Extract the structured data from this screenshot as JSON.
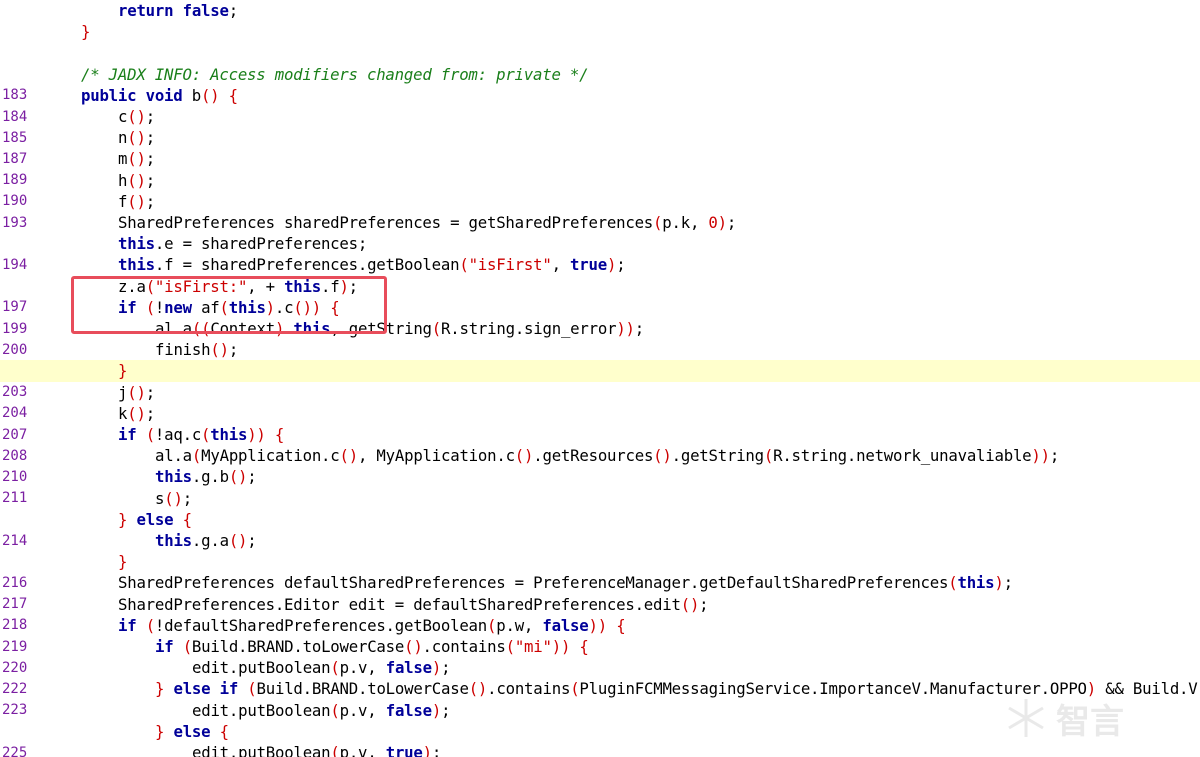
{
  "colors": {
    "keyword": "#000099",
    "string": "#cc0000",
    "bracket": "#cc0000",
    "comment": "#1a7f1a",
    "line_number": "#7b1fa2",
    "current_line_bg": "#ffffcc",
    "annotation_box": "#e84d5b"
  },
  "code_lines": [
    {
      "ln": "",
      "indent": 2,
      "tokens": [
        [
          "kw",
          "return"
        ],
        [
          "",
          " "
        ],
        [
          "kw",
          "false"
        ],
        [
          "",
          ";"
        ]
      ]
    },
    {
      "ln": "",
      "indent": 1,
      "tokens": [
        [
          "br",
          "}"
        ]
      ]
    },
    {
      "ln": "",
      "indent": 0,
      "tokens": []
    },
    {
      "ln": "",
      "indent": 1,
      "tokens": [
        [
          "cm",
          "/* JADX INFO: Access modifiers changed from: private */"
        ]
      ]
    },
    {
      "ln": "183",
      "indent": 1,
      "tokens": [
        [
          "kw",
          "public"
        ],
        [
          "",
          " "
        ],
        [
          "kw",
          "void"
        ],
        [
          "",
          " b"
        ],
        [
          "br",
          "()"
        ],
        [
          "",
          " "
        ],
        [
          "br",
          "{"
        ]
      ]
    },
    {
      "ln": "184",
      "indent": 2,
      "tokens": [
        [
          "",
          "c"
        ],
        [
          "br",
          "()"
        ],
        [
          "",
          ";"
        ]
      ]
    },
    {
      "ln": "185",
      "indent": 2,
      "tokens": [
        [
          "",
          "n"
        ],
        [
          "br",
          "()"
        ],
        [
          "",
          ";"
        ]
      ]
    },
    {
      "ln": "187",
      "indent": 2,
      "tokens": [
        [
          "",
          "m"
        ],
        [
          "br",
          "()"
        ],
        [
          "",
          ";"
        ]
      ]
    },
    {
      "ln": "189",
      "indent": 2,
      "tokens": [
        [
          "",
          "h"
        ],
        [
          "br",
          "()"
        ],
        [
          "",
          ";"
        ]
      ]
    },
    {
      "ln": "190",
      "indent": 2,
      "tokens": [
        [
          "",
          "f"
        ],
        [
          "br",
          "()"
        ],
        [
          "",
          ";"
        ]
      ]
    },
    {
      "ln": "193",
      "indent": 2,
      "tokens": [
        [
          "",
          "SharedPreferences sharedPreferences = getSharedPreferences"
        ],
        [
          "br",
          "("
        ],
        [
          "",
          "p.k, "
        ],
        [
          "nm",
          "0"
        ],
        [
          "br",
          ")"
        ],
        [
          "",
          ";"
        ]
      ]
    },
    {
      "ln": "",
      "indent": 2,
      "tokens": [
        [
          "kw",
          "this"
        ],
        [
          "",
          ".e = sharedPreferences;"
        ]
      ]
    },
    {
      "ln": "194",
      "indent": 2,
      "tokens": [
        [
          "kw",
          "this"
        ],
        [
          "",
          ".f = sharedPreferences.getBoolean"
        ],
        [
          "br",
          "("
        ],
        [
          "st",
          "\"isFirst\""
        ],
        [
          "",
          ", "
        ],
        [
          "kw",
          "true"
        ],
        [
          "br",
          ")"
        ],
        [
          "",
          ";"
        ]
      ]
    },
    {
      "ln": "",
      "indent": 2,
      "tokens": [
        [
          "",
          "z.a"
        ],
        [
          "br",
          "("
        ],
        [
          "st",
          "\"isFirst:\""
        ],
        [
          "",
          ", + "
        ],
        [
          "kw",
          "this"
        ],
        [
          "",
          ".f"
        ],
        [
          "br",
          ")"
        ],
        [
          "",
          ";"
        ]
      ]
    },
    {
      "ln": "197",
      "indent": 2,
      "tokens": [
        [
          "kw",
          "if"
        ],
        [
          "",
          " "
        ],
        [
          "br",
          "("
        ],
        [
          "",
          "!"
        ],
        [
          "kw",
          "new"
        ],
        [
          "",
          " af"
        ],
        [
          "br",
          "("
        ],
        [
          "kw",
          "this"
        ],
        [
          "br",
          ")"
        ],
        [
          "",
          ".c"
        ],
        [
          "br",
          "())"
        ],
        [
          "",
          " "
        ],
        [
          "br",
          "{"
        ]
      ]
    },
    {
      "ln": "199",
      "indent": 3,
      "tokens": [
        [
          "",
          "al.a"
        ],
        [
          "br",
          "(("
        ],
        [
          "",
          "Context"
        ],
        [
          "br",
          ")"
        ],
        [
          "",
          " "
        ],
        [
          "kw",
          "this"
        ],
        [
          "",
          ", getString"
        ],
        [
          "br",
          "("
        ],
        [
          "",
          "R.string.sign_error"
        ],
        [
          "br",
          "))"
        ],
        [
          "",
          ";"
        ]
      ]
    },
    {
      "ln": "200",
      "indent": 3,
      "tokens": [
        [
          "",
          "finish"
        ],
        [
          "br",
          "()"
        ],
        [
          "",
          ";"
        ]
      ]
    },
    {
      "ln": "",
      "indent": 2,
      "tokens": [
        [
          "br",
          "}"
        ]
      ],
      "current": true
    },
    {
      "ln": "203",
      "indent": 2,
      "tokens": [
        [
          "",
          "j"
        ],
        [
          "br",
          "()"
        ],
        [
          "",
          ";"
        ]
      ]
    },
    {
      "ln": "204",
      "indent": 2,
      "tokens": [
        [
          "",
          "k"
        ],
        [
          "br",
          "()"
        ],
        [
          "",
          ";"
        ]
      ]
    },
    {
      "ln": "207",
      "indent": 2,
      "tokens": [
        [
          "kw",
          "if"
        ],
        [
          "",
          " "
        ],
        [
          "br",
          "("
        ],
        [
          "",
          "!aq.c"
        ],
        [
          "br",
          "("
        ],
        [
          "kw",
          "this"
        ],
        [
          "br",
          "))"
        ],
        [
          "",
          " "
        ],
        [
          "br",
          "{"
        ]
      ]
    },
    {
      "ln": "208",
      "indent": 3,
      "tokens": [
        [
          "",
          "al.a"
        ],
        [
          "br",
          "("
        ],
        [
          "",
          "MyApplication.c"
        ],
        [
          "br",
          "()"
        ],
        [
          "",
          ", MyApplication.c"
        ],
        [
          "br",
          "()"
        ],
        [
          "",
          ".getResources"
        ],
        [
          "br",
          "()"
        ],
        [
          "",
          ".getString"
        ],
        [
          "br",
          "("
        ],
        [
          "",
          "R.string.network_unavaliable"
        ],
        [
          "br",
          "))"
        ],
        [
          "",
          ";"
        ]
      ]
    },
    {
      "ln": "210",
      "indent": 3,
      "tokens": [
        [
          "kw",
          "this"
        ],
        [
          "",
          ".g.b"
        ],
        [
          "br",
          "()"
        ],
        [
          "",
          ";"
        ]
      ]
    },
    {
      "ln": "211",
      "indent": 3,
      "tokens": [
        [
          "",
          "s"
        ],
        [
          "br",
          "()"
        ],
        [
          "",
          ";"
        ]
      ]
    },
    {
      "ln": "",
      "indent": 2,
      "tokens": [
        [
          "br",
          "}"
        ],
        [
          "",
          " "
        ],
        [
          "kw",
          "else"
        ],
        [
          "",
          " "
        ],
        [
          "br",
          "{"
        ]
      ]
    },
    {
      "ln": "214",
      "indent": 3,
      "tokens": [
        [
          "kw",
          "this"
        ],
        [
          "",
          ".g.a"
        ],
        [
          "br",
          "()"
        ],
        [
          "",
          ";"
        ]
      ]
    },
    {
      "ln": "",
      "indent": 2,
      "tokens": [
        [
          "br",
          "}"
        ]
      ]
    },
    {
      "ln": "216",
      "indent": 2,
      "tokens": [
        [
          "",
          "SharedPreferences defaultSharedPreferences = PreferenceManager.getDefaultSharedPreferences"
        ],
        [
          "br",
          "("
        ],
        [
          "kw",
          "this"
        ],
        [
          "br",
          ")"
        ],
        [
          "",
          ";"
        ]
      ]
    },
    {
      "ln": "217",
      "indent": 2,
      "tokens": [
        [
          "",
          "SharedPreferences.Editor edit = defaultSharedPreferences.edit"
        ],
        [
          "br",
          "()"
        ],
        [
          "",
          ";"
        ]
      ]
    },
    {
      "ln": "218",
      "indent": 2,
      "tokens": [
        [
          "kw",
          "if"
        ],
        [
          "",
          " "
        ],
        [
          "br",
          "("
        ],
        [
          "",
          "!defaultSharedPreferences.getBoolean"
        ],
        [
          "br",
          "("
        ],
        [
          "",
          "p.w, "
        ],
        [
          "kw",
          "false"
        ],
        [
          "br",
          "))"
        ],
        [
          "",
          " "
        ],
        [
          "br",
          "{"
        ]
      ]
    },
    {
      "ln": "219",
      "indent": 3,
      "tokens": [
        [
          "kw",
          "if"
        ],
        [
          "",
          " "
        ],
        [
          "br",
          "("
        ],
        [
          "",
          "Build.BRAND.toLowerCase"
        ],
        [
          "br",
          "()"
        ],
        [
          "",
          ".contains"
        ],
        [
          "br",
          "("
        ],
        [
          "st",
          "\"mi\""
        ],
        [
          "br",
          "))"
        ],
        [
          "",
          " "
        ],
        [
          "br",
          "{"
        ]
      ]
    },
    {
      "ln": "220",
      "indent": 4,
      "tokens": [
        [
          "",
          "edit.putBoolean"
        ],
        [
          "br",
          "("
        ],
        [
          "",
          "p.v, "
        ],
        [
          "kw",
          "false"
        ],
        [
          "br",
          ")"
        ],
        [
          "",
          ";"
        ]
      ]
    },
    {
      "ln": "222",
      "indent": 3,
      "tokens": [
        [
          "br",
          "}"
        ],
        [
          "",
          " "
        ],
        [
          "kw",
          "else"
        ],
        [
          "",
          " "
        ],
        [
          "kw",
          "if"
        ],
        [
          "",
          " "
        ],
        [
          "br",
          "("
        ],
        [
          "",
          "Build.BRAND.toLowerCase"
        ],
        [
          "br",
          "()"
        ],
        [
          "",
          ".contains"
        ],
        [
          "br",
          "("
        ],
        [
          "",
          "PluginFCMMessagingService.ImportanceV.Manufacturer.OPPO"
        ],
        [
          "br",
          ")"
        ],
        [
          "",
          " && Build.V"
        ]
      ]
    },
    {
      "ln": "223",
      "indent": 4,
      "tokens": [
        [
          "",
          "edit.putBoolean"
        ],
        [
          "br",
          "("
        ],
        [
          "",
          "p.v, "
        ],
        [
          "kw",
          "false"
        ],
        [
          "br",
          ")"
        ],
        [
          "",
          ";"
        ]
      ]
    },
    {
      "ln": "",
      "indent": 3,
      "tokens": [
        [
          "br",
          "}"
        ],
        [
          "",
          " "
        ],
        [
          "kw",
          "else"
        ],
        [
          "",
          " "
        ],
        [
          "br",
          "{"
        ]
      ]
    },
    {
      "ln": "225",
      "indent": 4,
      "tokens": [
        [
          "",
          "edit.putBoolean"
        ],
        [
          "br",
          "("
        ],
        [
          "",
          "p.v, "
        ],
        [
          "kw",
          "true"
        ],
        [
          "br",
          ")"
        ],
        [
          "",
          ";"
        ]
      ]
    }
  ],
  "watermark": {
    "text": "智言"
  }
}
